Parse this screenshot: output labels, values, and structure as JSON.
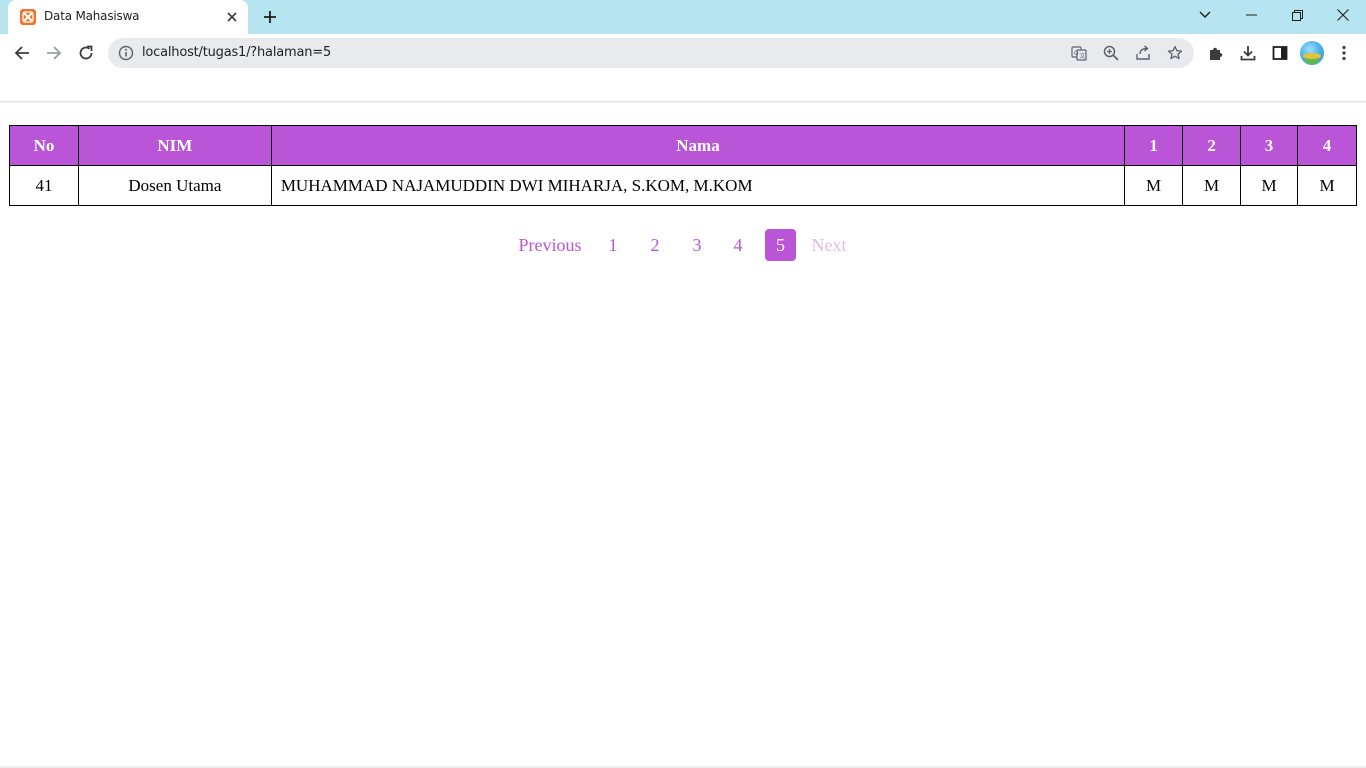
{
  "browser": {
    "tab_title": "Data Mahasiswa",
    "url": "localhost/tugas1/?halaman=5",
    "icons": [
      "xampp-favicon-icon",
      "close-icon",
      "plus-icon",
      "chevron-down-icon",
      "minimize-icon",
      "restore-icon",
      "window-close-icon",
      "back-arrow-icon",
      "forward-arrow-icon",
      "reload-icon",
      "info-icon",
      "translate-icon",
      "zoom-icon",
      "share-icon",
      "star-icon",
      "puzzle-icon",
      "download-icon",
      "sidepanel-icon",
      "kebab-menu-icon"
    ]
  },
  "table": {
    "headers": [
      "No",
      "NIM",
      "Nama",
      "1",
      "2",
      "3",
      "4"
    ],
    "rows": [
      [
        "41",
        "Dosen Utama",
        "MUHAMMAD NAJAMUDDIN DWI MIHARJA, S.KOM, M.KOM",
        "M",
        "M",
        "M",
        "M"
      ]
    ]
  },
  "pagination": {
    "previous": "Previous",
    "pages": [
      "1",
      "2",
      "3",
      "4",
      "5"
    ],
    "current": "5",
    "next": "Next"
  },
  "colors": {
    "accent": "#b955d6",
    "tabstrip": "#b6e5f1",
    "disabled": "#e2b8ee"
  }
}
